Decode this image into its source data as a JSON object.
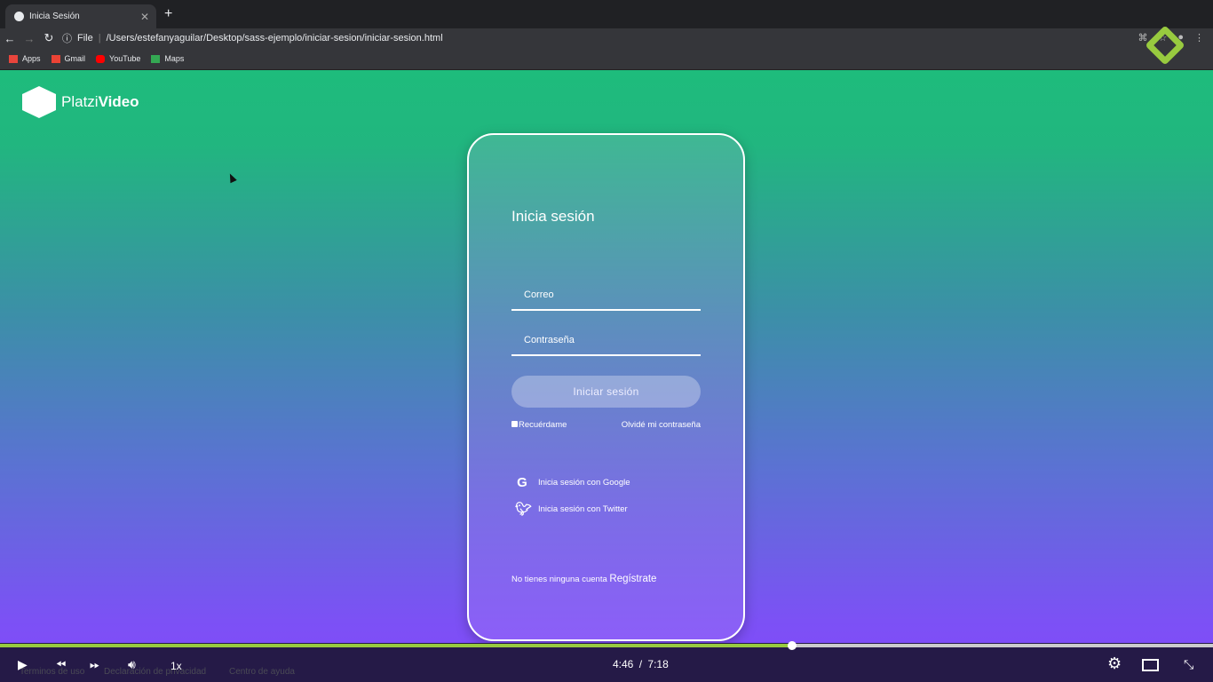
{
  "browser": {
    "tab_title": "Inicia Sesión",
    "url_scheme": "File",
    "url": "/Users/estefanyaguilar/Desktop/sass-ejemplo/iniciar-sesion/iniciar-sesion.html",
    "bookmarks": [
      {
        "label": "Apps",
        "icon": "apps-grid-icon",
        "color": "#e8453c"
      },
      {
        "label": "Gmail",
        "icon": "gmail-icon",
        "color": "#ea4335"
      },
      {
        "label": "YouTube",
        "icon": "youtube-icon",
        "color": "#ff0000"
      },
      {
        "label": "Maps",
        "icon": "maps-icon",
        "color": "#34a853"
      }
    ]
  },
  "brand": {
    "name_light": "Platzi",
    "name_bold": "Video"
  },
  "login": {
    "title": "Inicia sesión",
    "email_placeholder": "Correo",
    "password_placeholder": "Contraseña",
    "submit": "Iniciar sesión",
    "remember": "Recuérdame",
    "forgot": "Olvidé mi contraseña",
    "google": "Inicia sesión con Google",
    "twitter": "Inicia sesión con Twitter",
    "no_account": "No tienes ninguna cuenta",
    "register": "Regístrate"
  },
  "footer": {
    "links": [
      "Terminos de uso",
      "Declaración de privacidad",
      "Centro de ayuda"
    ]
  },
  "player": {
    "speed": "1x",
    "current": "4:46",
    "separator": "/",
    "duration": "7:18",
    "progress": 0.653,
    "accent": "#98ca3f"
  }
}
